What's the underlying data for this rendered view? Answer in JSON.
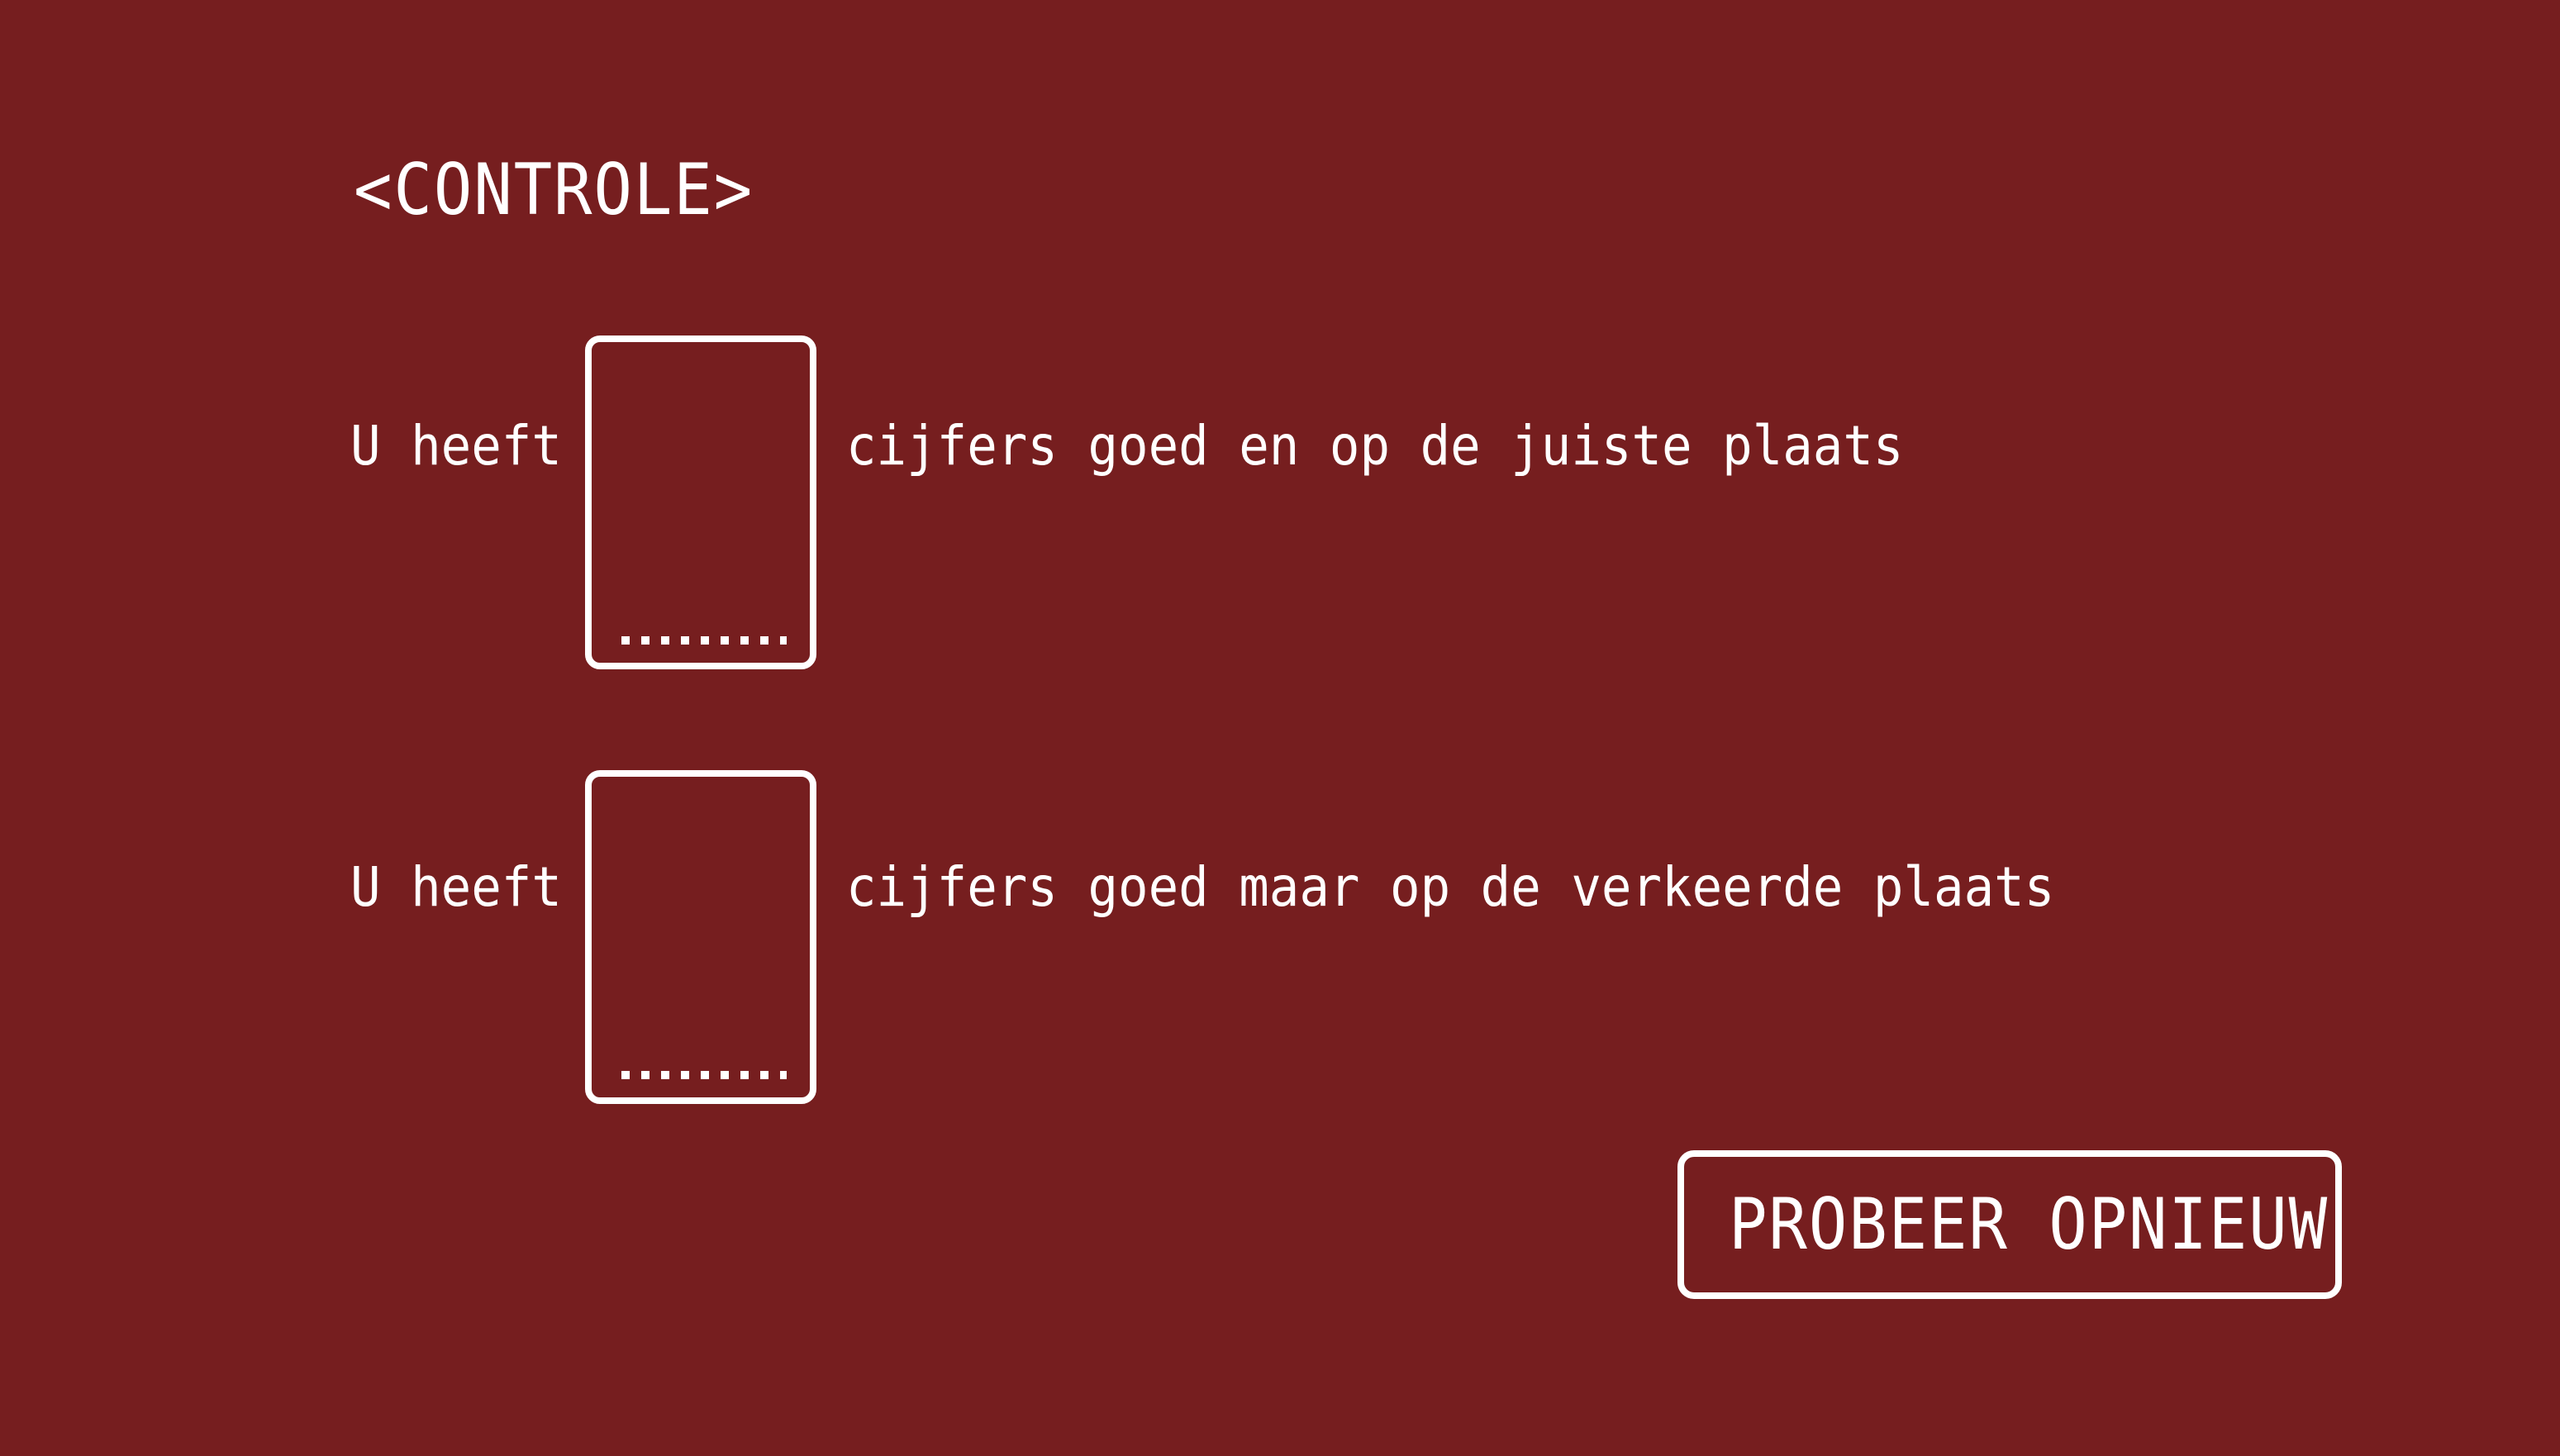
{
  "screen": {
    "title": "<CONTROLE>",
    "background_color": "#761e1f",
    "foreground_color": "#ffffff"
  },
  "rows": [
    {
      "prefix": "U heeft",
      "input_value": "",
      "input_placeholder": "........",
      "suffix": "cijfers goed en op de juiste plaats"
    },
    {
      "prefix": "U heeft",
      "input_value": "",
      "input_placeholder": "........",
      "suffix": "cijfers goed maar op de verkeerde plaats"
    }
  ],
  "button": {
    "label": "PROBEER OPNIEUW"
  }
}
